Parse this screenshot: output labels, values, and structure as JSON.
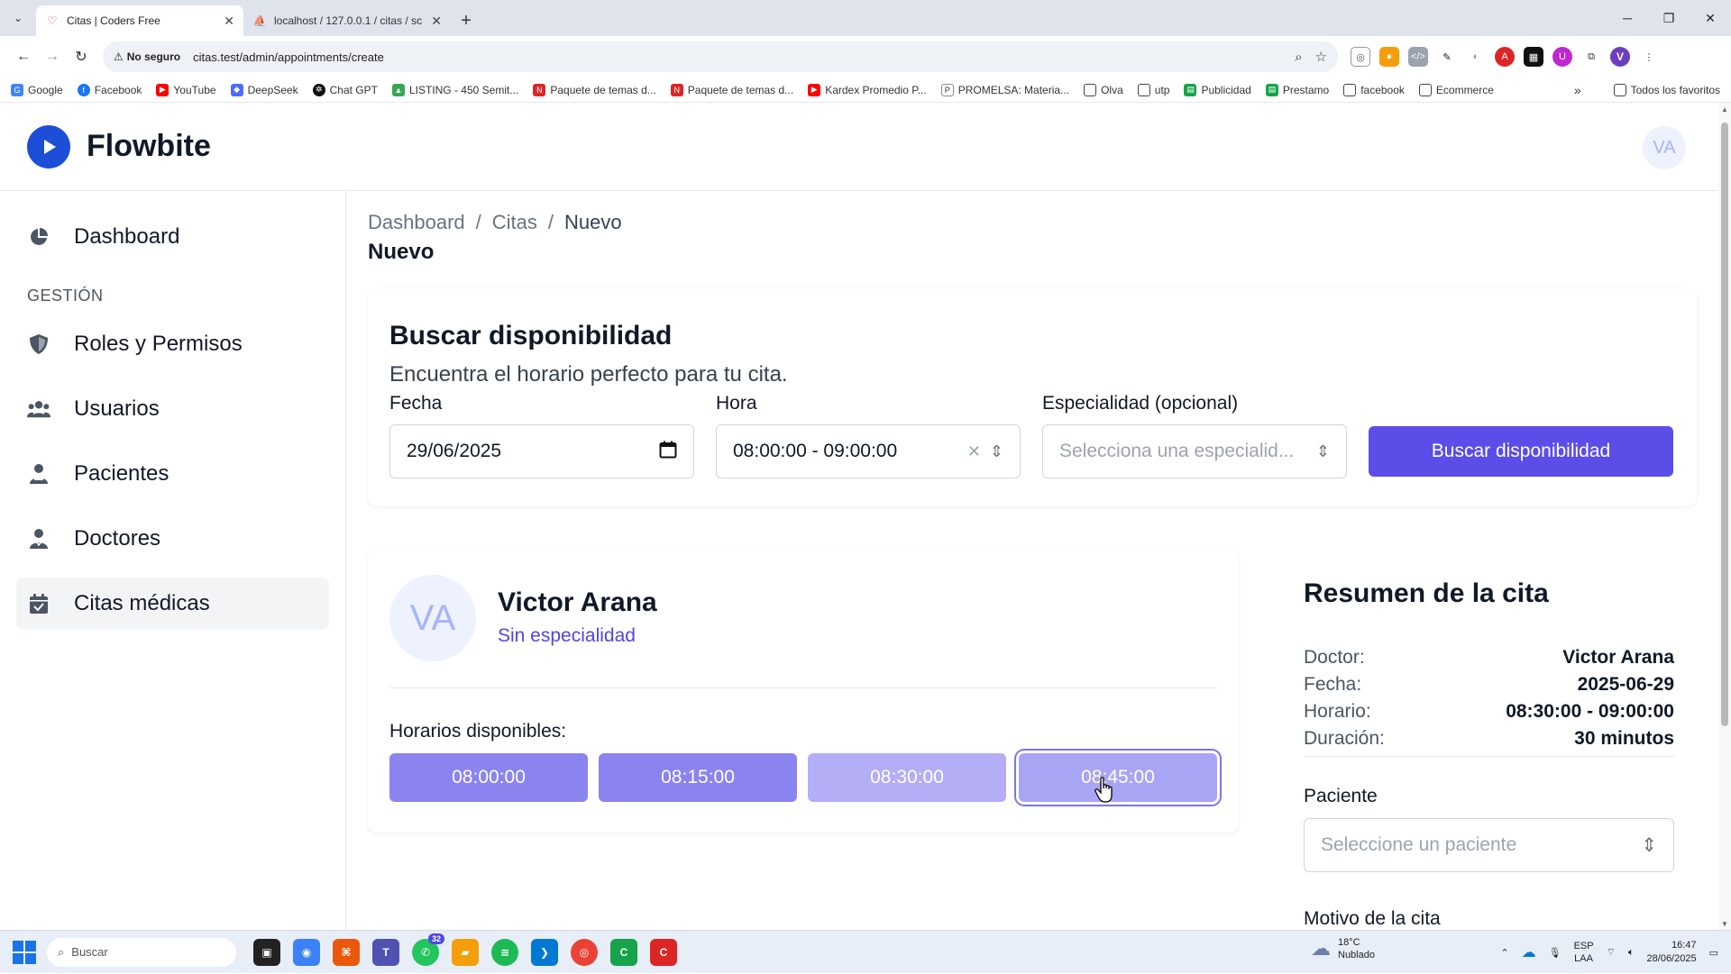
{
  "browser": {
    "tabs": [
      {
        "title": "Citas | Coders Free",
        "active": true
      },
      {
        "title": "localhost / 127.0.0.1 / citas / sc",
        "active": false
      }
    ],
    "address": {
      "security_label": "No seguro",
      "url": "citas.test/admin/appointments/create"
    },
    "bookmarks": [
      "Google",
      "Facebook",
      "YouTube",
      "DeepSeek",
      "Chat GPT",
      "LISTING - 450 Semit...",
      "Paquete de temas d...",
      "Paquete de temas d...",
      "Kardex Promedio P...",
      "PROMELSA: Materia...",
      "Olva",
      "utp",
      "Publicidad",
      "Prestamo",
      "facebook",
      "Ecommerce"
    ],
    "bookmarks_all": "Todos los favoritos",
    "profile_initial": "V"
  },
  "app": {
    "brand": "Flowbite",
    "user_initials": "VA"
  },
  "sidebar": {
    "items": [
      {
        "label": "Dashboard"
      },
      {
        "label": "Roles y Permisos"
      },
      {
        "label": "Usuarios"
      },
      {
        "label": "Pacientes"
      },
      {
        "label": "Doctores"
      },
      {
        "label": "Citas médicas"
      }
    ],
    "section": "GESTIÓN"
  },
  "breadcrumb": [
    "Dashboard",
    "Citas",
    "Nuevo"
  ],
  "page_title": "Nuevo",
  "search": {
    "title": "Buscar disponibilidad",
    "subtitle": "Encuentra el horario perfecto para tu cita.",
    "fecha_label": "Fecha",
    "fecha_value": "29/06/2025",
    "hora_label": "Hora",
    "hora_value": "08:00:00 - 09:00:00",
    "especialidad_label": "Especialidad (opcional)",
    "especialidad_placeholder": "Selecciona una especialid...",
    "button": "Buscar disponibilidad"
  },
  "doctor": {
    "initials": "VA",
    "name": "Victor Arana",
    "specialty": "Sin especialidad",
    "slots_label": "Horarios disponibles:",
    "slots": [
      "08:00:00",
      "08:15:00",
      "08:30:00",
      "08:45:00"
    ]
  },
  "summary": {
    "title": "Resumen de la cita",
    "rows": [
      {
        "k": "Doctor:",
        "v": "Victor Arana"
      },
      {
        "k": "Fecha:",
        "v": "2025-06-29"
      },
      {
        "k": "Horario:",
        "v": "08:30:00 - 09:00:00"
      },
      {
        "k": "Duración:",
        "v": "30 minutos"
      }
    ],
    "paciente_label": "Paciente",
    "paciente_placeholder": "Seleccione un paciente",
    "motivo_label": "Motivo de la cita"
  },
  "taskbar": {
    "search_placeholder": "Buscar",
    "whatsapp_badge": "32",
    "weather_temp": "18°C",
    "weather_desc": "Nublado",
    "lang_1": "ESP",
    "lang_2": "LAA",
    "time": "16:47",
    "date": "28/06/2025"
  },
  "colors": {
    "primary": "#5b4de8",
    "slot": "#8b83f0",
    "accent_text": "#4f46e5"
  }
}
